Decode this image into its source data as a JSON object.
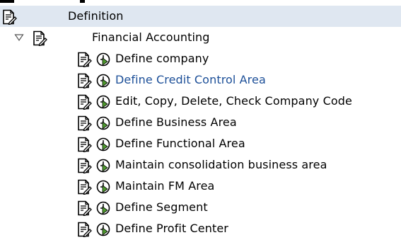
{
  "tree": {
    "header": {
      "label": "Definition",
      "icon": "document-icon"
    },
    "section": {
      "label": "Financial Accounting",
      "icon": "document-icon",
      "expanded": true
    },
    "items": [
      {
        "label": "Define company",
        "icons": [
          "document-icon",
          "execute-clock-icon"
        ],
        "highlighted": false
      },
      {
        "label": "Define Credit Control Area",
        "icons": [
          "document-icon",
          "execute-clock-icon"
        ],
        "highlighted": true
      },
      {
        "label": "Edit, Copy, Delete, Check Company Code",
        "icons": [
          "document-icon",
          "execute-clock-icon"
        ],
        "highlighted": false
      },
      {
        "label": "Define Business Area",
        "icons": [
          "document-icon",
          "execute-clock-icon"
        ],
        "highlighted": false
      },
      {
        "label": "Define Functional Area",
        "icons": [
          "document-icon",
          "execute-clock-icon"
        ],
        "highlighted": false
      },
      {
        "label": "Maintain consolidation business area",
        "icons": [
          "document-icon",
          "execute-clock-icon"
        ],
        "highlighted": false
      },
      {
        "label": "Maintain FM Area",
        "icons": [
          "document-icon",
          "execute-clock-icon"
        ],
        "highlighted": false
      },
      {
        "label": "Define Segment",
        "icons": [
          "document-icon",
          "execute-clock-icon"
        ],
        "highlighted": false
      },
      {
        "label": "Define Profit Center",
        "icons": [
          "document-icon",
          "execute-clock-icon"
        ],
        "highlighted": false
      }
    ]
  },
  "colors": {
    "header_band": "#dfe7f1",
    "link_text": "#1c4f98",
    "clock_green": "#4d9a2d"
  }
}
